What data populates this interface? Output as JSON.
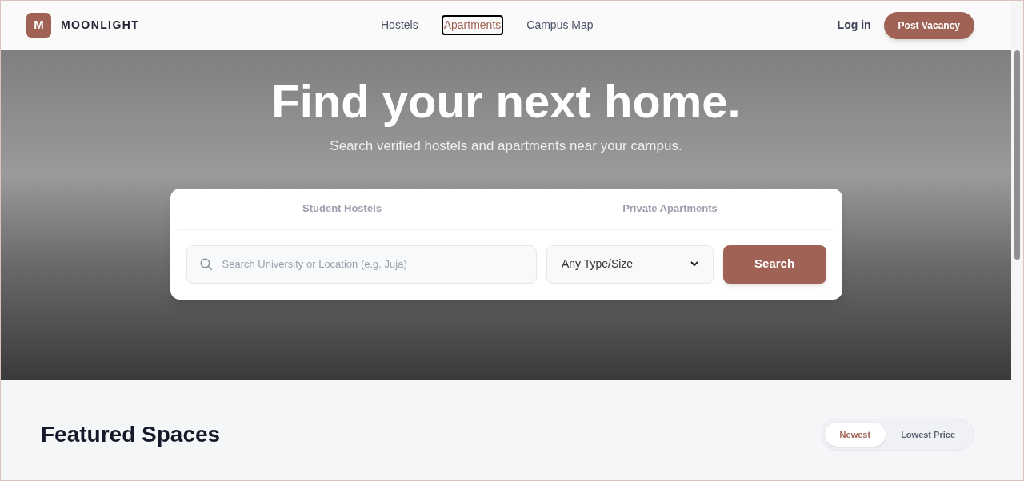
{
  "brand": {
    "logo_letter": "M",
    "name": "MOONLIGHT"
  },
  "nav": [
    {
      "label": "Hostels",
      "selected": false
    },
    {
      "label": "Apartments",
      "selected": true
    },
    {
      "label": "Campus Map",
      "selected": false
    }
  ],
  "login": "Log in",
  "post_button": "Post Vacancy",
  "hero": {
    "title": "Find your next home.",
    "subtitle": "Search verified hostels and apartments near your campus."
  },
  "search_tabs": [
    {
      "label": "Student Hostels",
      "selected": false
    },
    {
      "label": "Private Apartments",
      "selected": false
    }
  ],
  "search": {
    "placeholder": "Search University or Location (e.g. Juja)",
    "type_select": "Any Type/Size",
    "button": "Search"
  },
  "featured": {
    "title": "Featured Spaces",
    "sort": [
      {
        "label": "Newest",
        "selected": true
      },
      {
        "label": "Lowest Price",
        "selected": false
      }
    ]
  }
}
